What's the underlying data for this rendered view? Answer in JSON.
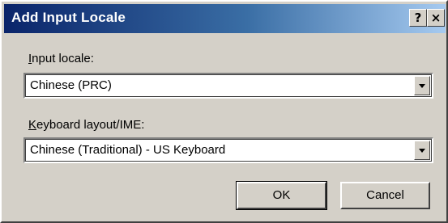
{
  "window": {
    "title": "Add Input Locale",
    "help_label": "?",
    "close_label": "×"
  },
  "input_locale": {
    "label_mnemonic": "I",
    "label_rest": "nput locale:",
    "selected_value": "Chinese (PRC)"
  },
  "keyboard_layout": {
    "label_mnemonic": "K",
    "label_rest": "eyboard layout/IME:",
    "selected_value": "Chinese (Traditional) - US Keyboard"
  },
  "buttons": {
    "ok_label": "OK",
    "cancel_label": "Cancel"
  },
  "colors": {
    "title_gradient_start": "#0a246a",
    "title_gradient_end": "#a6caf0",
    "dialog_face": "#d4d0c8"
  }
}
